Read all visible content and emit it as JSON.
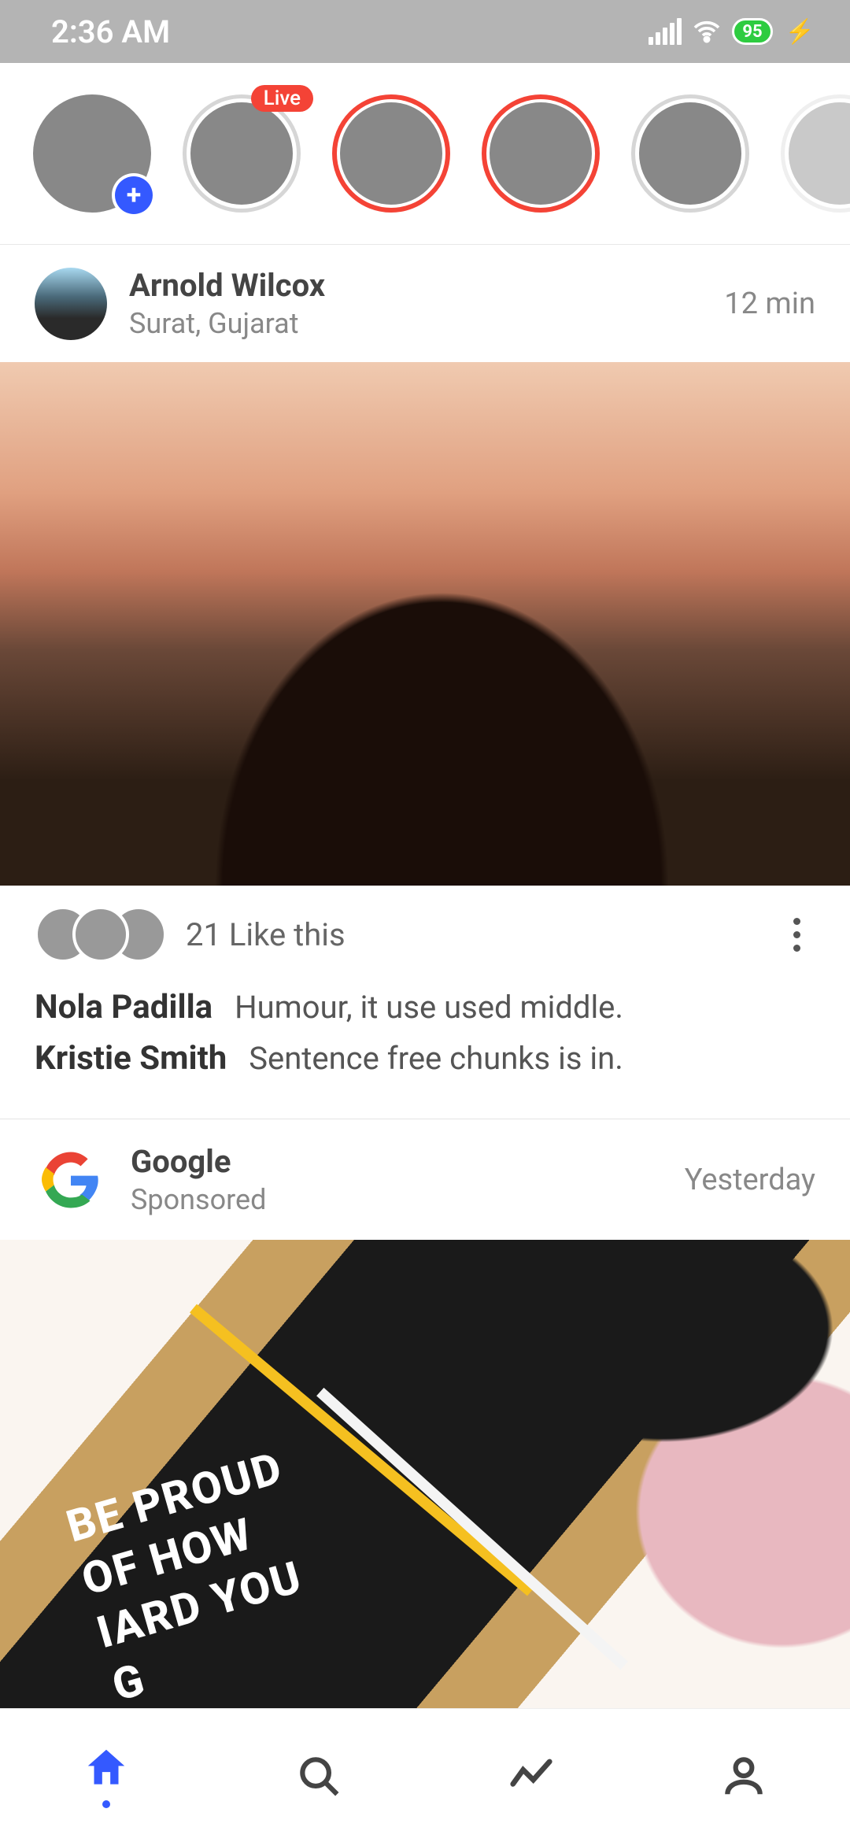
{
  "status": {
    "time": "2:36 AM",
    "battery_percent": "95"
  },
  "stories": {
    "live_badge": "Live",
    "items": [
      {
        "kind": "own"
      },
      {
        "kind": "live"
      },
      {
        "kind": "unseen"
      },
      {
        "kind": "unseen"
      },
      {
        "kind": "seen"
      },
      {
        "kind": "dim"
      }
    ]
  },
  "feed": {
    "post1": {
      "author_name": "Arnold Wilcox",
      "author_location": "Surat, Gujarat",
      "time": "12 min",
      "likes_text": "21 Like this",
      "comments": [
        {
          "name": "Nola Padilla",
          "text": "Humour, it use used middle."
        },
        {
          "name": "Kristie Smith",
          "text": "Sentence free chunks is in."
        }
      ]
    },
    "sponsored": {
      "brand": "Google",
      "label": "Sponsored",
      "time": "Yesterday",
      "board_lines": [
        "BE PROUD",
        "OF HOW",
        "IARD YOU",
        "G"
      ]
    }
  },
  "colors": {
    "accent": "#3459ff",
    "story_unseen": "#f44336"
  }
}
